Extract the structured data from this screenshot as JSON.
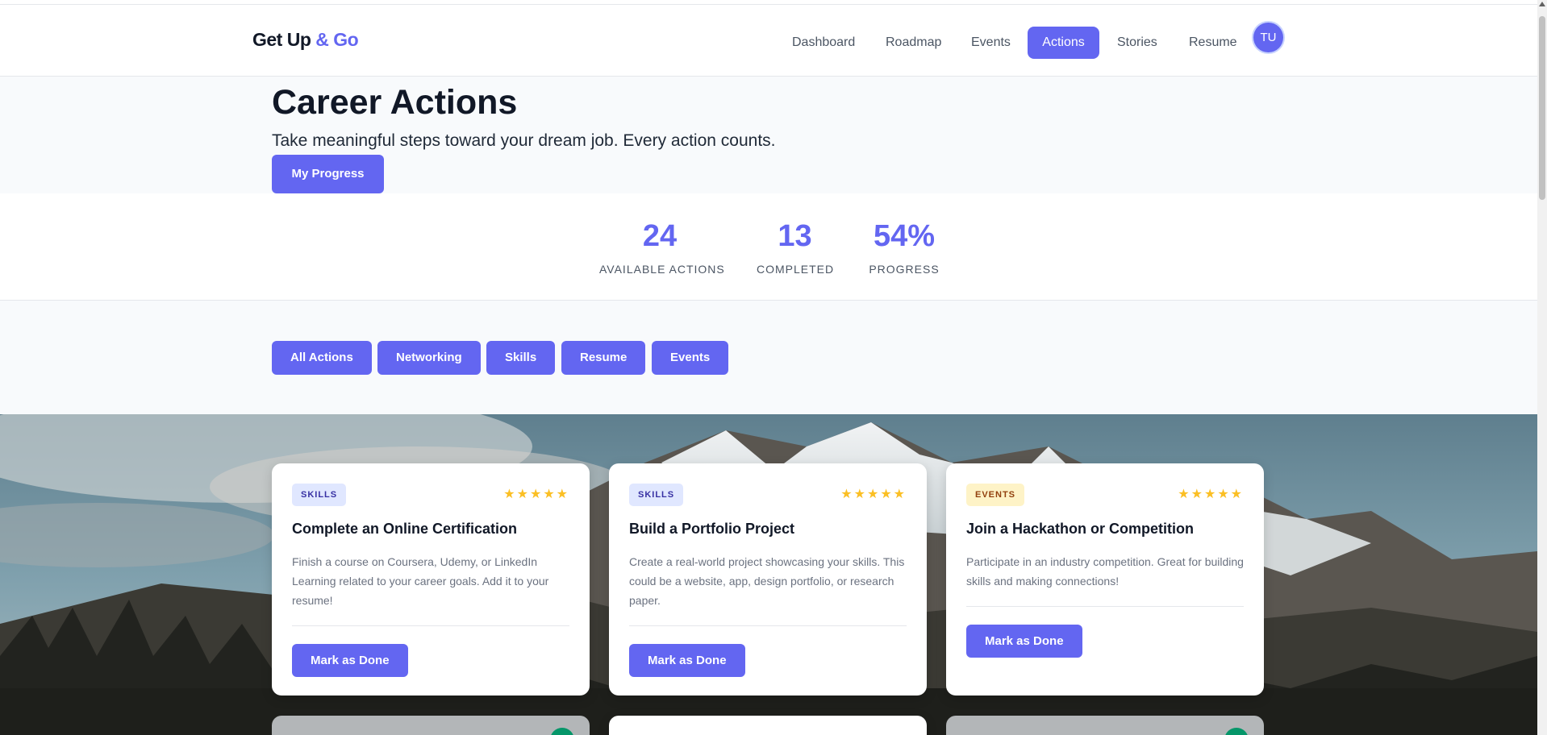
{
  "brand": {
    "name": "Get Up",
    "accent": "& Go",
    "accent_color": "#6366f1"
  },
  "nav": {
    "items": [
      {
        "label": "Dashboard",
        "active": false
      },
      {
        "label": "Roadmap",
        "active": false
      },
      {
        "label": "Events",
        "active": false
      },
      {
        "label": "Actions",
        "active": true
      },
      {
        "label": "Stories",
        "active": false
      },
      {
        "label": "Resume",
        "active": false
      }
    ],
    "avatar_initials": "TU"
  },
  "hero": {
    "title": "Career Actions",
    "subtitle": "Take meaningful steps toward your dream job. Every action counts.",
    "progress_button": "My Progress"
  },
  "stats": [
    {
      "value": "24",
      "label": "AVAILABLE ACTIONS"
    },
    {
      "value": "13",
      "label": "COMPLETED"
    },
    {
      "value": "54%",
      "label": "PROGRESS"
    }
  ],
  "filters": [
    "All Actions",
    "Networking",
    "Skills",
    "Resume",
    "Events"
  ],
  "cards": [
    {
      "badge": "SKILLS",
      "badge_type": "skills",
      "rating": 5,
      "stars": "★★★★★",
      "title": "Complete an Online Certification",
      "description": "Finish a course on Coursera, Udemy, or LinkedIn Learning related to your career goals. Add it to your resume!",
      "button": "Mark as Done"
    },
    {
      "badge": "SKILLS",
      "badge_type": "skills",
      "rating": 5,
      "stars": "★★★★★",
      "title": "Build a Portfolio Project",
      "description": "Create a real-world project showcasing your skills. This could be a website, app, design portfolio, or research paper.",
      "button": "Mark as Done"
    },
    {
      "badge": "EVENTS",
      "badge_type": "events",
      "rating": 5,
      "stars": "★★★★★",
      "title": "Join a Hackathon or Competition",
      "description": "Participate in an industry competition. Great for building skills and making connections!",
      "button": "Mark as Done"
    }
  ],
  "colors": {
    "primary": "#6366f1",
    "star": "#fbbf24",
    "completed_marker": "#059669"
  }
}
